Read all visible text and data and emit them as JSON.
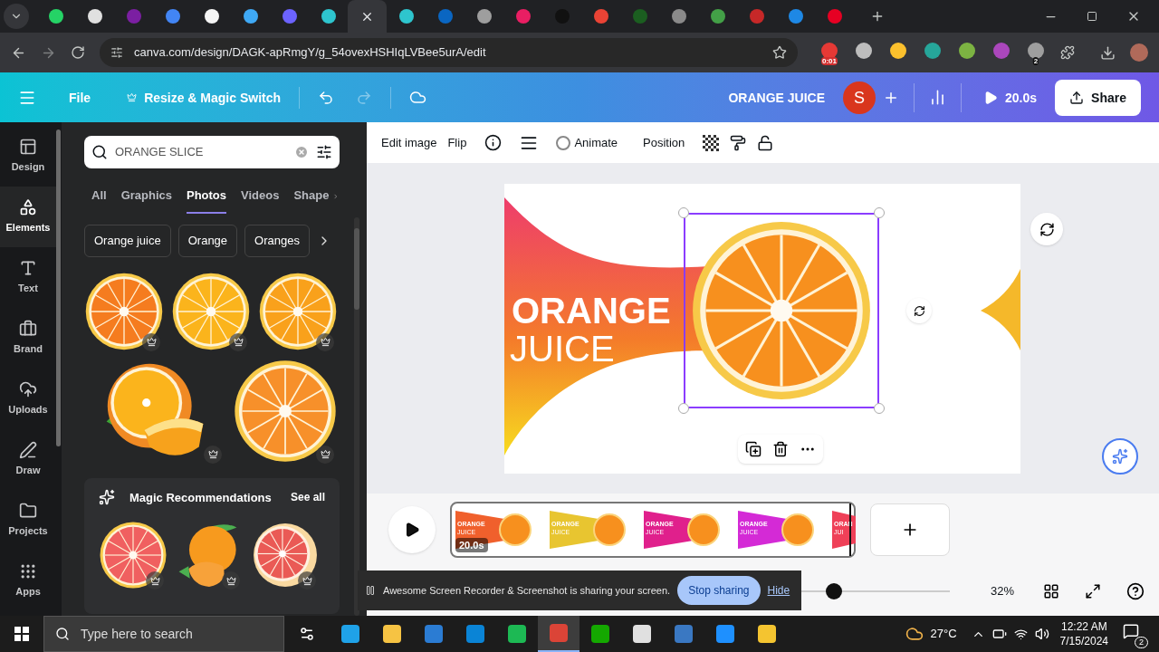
{
  "browser": {
    "tabs": [
      {
        "color": "#25d366",
        "selected": false
      },
      {
        "color": "#e0e0e0",
        "selected": false
      },
      {
        "color": "#7b1fa2",
        "selected": false
      },
      {
        "color": "#4285f4",
        "selected": false
      },
      {
        "color": "#f5f5f5",
        "selected": false
      },
      {
        "color": "#3fa9f5",
        "selected": false
      },
      {
        "color": "#6c63ff",
        "selected": false
      },
      {
        "color": "#2ec5ce",
        "selected": false
      },
      {
        "selected": true
      },
      {
        "color": "#2ec5ce",
        "selected": false
      },
      {
        "color": "#0a66c2",
        "selected": false
      },
      {
        "color": "#9e9e9e",
        "selected": false
      },
      {
        "color": "#e91e63",
        "selected": false
      },
      {
        "color": "#111111",
        "selected": false
      },
      {
        "color": "#ea4335",
        "selected": false
      },
      {
        "color": "#1b5e20",
        "selected": false
      },
      {
        "color": "#8a8a8a",
        "selected": false
      },
      {
        "color": "#43a047",
        "selected": false
      },
      {
        "color": "#c62828",
        "selected": false
      },
      {
        "color": "#1e88e5",
        "selected": false
      },
      {
        "color": "#e60023",
        "selected": false
      }
    ],
    "url": "canva.com/design/DAGK-apRmgY/g_54ovexHSHIqLVBee5urA/edit",
    "extensions": [
      {
        "color": "#e53935",
        "badge": "0:01"
      },
      {
        "color": "#bdbdbd"
      },
      {
        "color": "#fbc02d"
      },
      {
        "color": "#26a69a"
      },
      {
        "color": "#7cb342"
      },
      {
        "color": "#ab47bc"
      },
      {
        "color": "#9e9e9e",
        "badge": "2"
      }
    ]
  },
  "header": {
    "file": "File",
    "resize": "Resize & Magic Switch",
    "redo": {
      "disabled": true
    },
    "title": "ORANGE JUICE",
    "avatar": "S",
    "play": "20.0s",
    "share": "Share"
  },
  "rail": [
    {
      "label": "Design",
      "selected": false
    },
    {
      "label": "Elements",
      "selected": true
    },
    {
      "label": "Text",
      "selected": false
    },
    {
      "label": "Brand",
      "selected": false
    },
    {
      "label": "Uploads",
      "selected": false
    },
    {
      "label": "Draw",
      "selected": false
    },
    {
      "label": "Projects",
      "selected": false
    },
    {
      "label": "Apps",
      "selected": false
    }
  ],
  "panel": {
    "search": {
      "value": "ORANGE SLICE"
    },
    "categories": [
      {
        "label": "All",
        "selected": false
      },
      {
        "label": "Graphics",
        "selected": false
      },
      {
        "label": "Photos",
        "selected": true
      },
      {
        "label": "Videos",
        "selected": false
      },
      {
        "label": "Shape",
        "selected": false
      }
    ],
    "chips": [
      "Orange juice",
      "Orange",
      "Oranges"
    ],
    "photos": [
      {
        "kind": "slice",
        "color": "#f57c1f",
        "premium": true
      },
      {
        "kind": "slice",
        "color": "#fbb41c",
        "premium": true
      },
      {
        "kind": "slice",
        "color": "#f9a11b",
        "premium": true
      },
      {
        "kind": "cut",
        "color": "#fbb41c",
        "premium": true
      },
      {
        "kind": "slice",
        "color": "#f7902a",
        "premium": true
      }
    ],
    "magic": {
      "title": "Magic Recommendations",
      "see_all": "See all",
      "photos": [
        {
          "kind": "slice",
          "color": "#f06060",
          "premium": true
        },
        {
          "kind": "mandarin",
          "color": "#f79a1e",
          "premium": true
        },
        {
          "kind": "half",
          "color": "#ea5a55",
          "premium": true
        }
      ]
    }
  },
  "toolbar": {
    "edit_image": "Edit image",
    "flip": "Flip",
    "animate": "Animate",
    "position": "Position"
  },
  "slide": {
    "line1": "ORANGE",
    "line2": "JUICE",
    "image_selected": true
  },
  "timeline": {
    "duration": "20.0s",
    "thumbnails": [
      {
        "line1": "ORANGE",
        "line2": "JUICE",
        "color": "#f0602c"
      },
      {
        "line1": "ORANGE",
        "line2": "JUICE",
        "color": "#e8c530"
      },
      {
        "line1": "ORANGE",
        "line2": "JUICE",
        "color": "#e0208c"
      },
      {
        "line1": "ORANGE",
        "line2": "JUICE",
        "color": "#d42ad6"
      },
      {
        "line1": "ORAN",
        "line2": "JUI",
        "color": "#ef4058"
      }
    ]
  },
  "zoom": {
    "level": 0.31,
    "reading": "32%"
  },
  "sharing": {
    "text": "Awesome Screen Recorder & Screenshot is sharing your screen.",
    "stop": "Stop sharing",
    "hide": "Hide"
  },
  "taskbar": {
    "search_placeholder": "Type here to search",
    "apps": [
      {
        "color": "#1fa2e8",
        "selected": false
      },
      {
        "color": "#f6c343",
        "selected": false
      },
      {
        "color": "#2b7cd3",
        "selected": false
      },
      {
        "color": "#0a84d6",
        "selected": false
      },
      {
        "color": "#1db954",
        "selected": false
      },
      {
        "color": "#db4437",
        "selected": true
      },
      {
        "color": "#14a800",
        "selected": false
      },
      {
        "color": "#e0e0e0",
        "selected": false
      },
      {
        "color": "#3a78c2",
        "selected": false
      },
      {
        "color": "#1e90ff",
        "selected": false
      },
      {
        "color": "#f4c430",
        "selected": false
      }
    ],
    "weather": "27°C",
    "time": "12:22 AM",
    "date": "7/15/2024",
    "notifications": "2"
  }
}
